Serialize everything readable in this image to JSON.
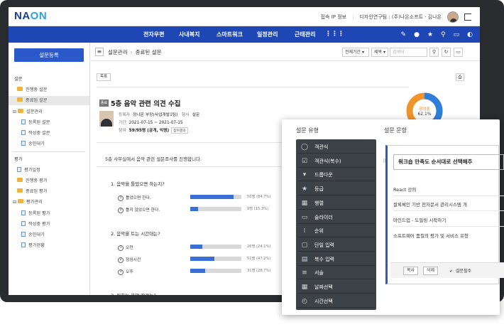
{
  "header": {
    "logo_a": "NA",
    "logo_b": "ON",
    "ip_info": "접속 IP 정보",
    "user_info": "디자인연구팀 : (주)나온소프트 · 김나온"
  },
  "nav": {
    "items": [
      "전자우편",
      "사내복지",
      "스마트워크",
      "일정관리",
      "근태관리"
    ]
  },
  "sidebar": {
    "register_button": "설문등록",
    "section_survey": "설문",
    "survey_items": [
      "진행중 설문",
      "종료된 설문"
    ],
    "survey_admin": "설문관리",
    "survey_admin_items": [
      "등록된 설문",
      "작성중 설문",
      "승인대기"
    ],
    "section_eval": "평가",
    "eval_items": [
      "평가일정",
      "진행중 평가",
      "종료된 평가"
    ],
    "eval_admin": "평가관리",
    "eval_admin_items": [
      "등록된 평가",
      "작성중 평가",
      "승인대기",
      "평가현황"
    ]
  },
  "toolbar": {
    "crumb_root": "설문관리",
    "crumb_current": "종료된 설문",
    "period_select": "전체기간",
    "field_select": "제목",
    "search_placeholder": "검색어"
  },
  "survey": {
    "list_button": "목록",
    "badge": "종료",
    "title": "5층 음악 관련 의견 수집",
    "registrant_label": "등록자",
    "registrant": "정나온 부장(사업개발1팀)",
    "format_label": "형식",
    "format": "설문",
    "period_label": "기간",
    "period": "2021-07-15 ~ 2021-07-15",
    "participation_label": "참여",
    "participation": "59/95명 (공개, 익명)",
    "result_button": "참여결과",
    "donut_label": "참여율",
    "donut_value": "62.1%",
    "participation_rate": 62.1,
    "description": "5층 사무실에서 음악 관련  설문조사를 진행합니다.",
    "questions": [
      {
        "title": "1. 음악을 틀었으면 하는지?",
        "options": [
          {
            "num": "1",
            "label": "틀었으면 한다.",
            "pct": 84.7,
            "text": "50명 (84.7%)"
          },
          {
            "num": "2",
            "label": "틀지 않았으면 한다.",
            "pct": 15.3,
            "text": "9명 (15.3%)"
          }
        ]
      },
      {
        "title": "2. 음악을 트는 시간대는?",
        "options": [
          {
            "num": "1",
            "label": "오전",
            "pct": 24.1,
            "text": "26명 (24.1%)"
          },
          {
            "num": "2",
            "label": "점심시간",
            "pct": 47.2,
            "text": "51명 (47.2%)"
          },
          {
            "num": "3",
            "label": "오후",
            "pct": 28.7,
            "text": "31명 (28.7%)"
          }
        ]
      },
      {
        "title": "3. 원하는 음악 장르는?",
        "options": []
      }
    ]
  },
  "panel": {
    "types_title": "설문 유형",
    "editor_title": "설문 문항",
    "types": [
      {
        "label": "객관식",
        "icon": "check-circle-icon"
      },
      {
        "label": "객관식(복수)",
        "icon": "check-square-icon"
      },
      {
        "label": "드롭다운",
        "icon": "dropdown-icon"
      },
      {
        "label": "등급",
        "icon": "star-icon"
      },
      {
        "label": "행렬",
        "icon": "grid-icon"
      },
      {
        "label": "슬라이더",
        "icon": "slider-icon"
      },
      {
        "label": "순위",
        "icon": "rank-icon"
      },
      {
        "label": "단일 입력",
        "icon": "single-input-icon"
      },
      {
        "label": "복수 입력",
        "icon": "multi-input-icon"
      },
      {
        "label": "서술",
        "icon": "text-lines-icon"
      },
      {
        "label": "날짜선택",
        "icon": "calendar-icon"
      },
      {
        "label": "시간선택",
        "icon": "clock-icon"
      }
    ],
    "question": "워크숍 만족도 순서대로 선택해주",
    "options": [
      "React 강의",
      "쌀록체인 기반 전자문서 관리시스템 개",
      "마인드업 - 도필링 시작하기",
      "소프트웨어 품질의 평가 및 서비스 유형"
    ],
    "copy_button": "복사",
    "delete_button": "삭제",
    "required_label": "설문필수"
  },
  "colors": {
    "nav_bg": "#1e47b5",
    "accent": "#2b59c9",
    "bar": "#3a6fd6",
    "donut_main": "#2f7fd8",
    "donut_rest": "#f0932b"
  }
}
